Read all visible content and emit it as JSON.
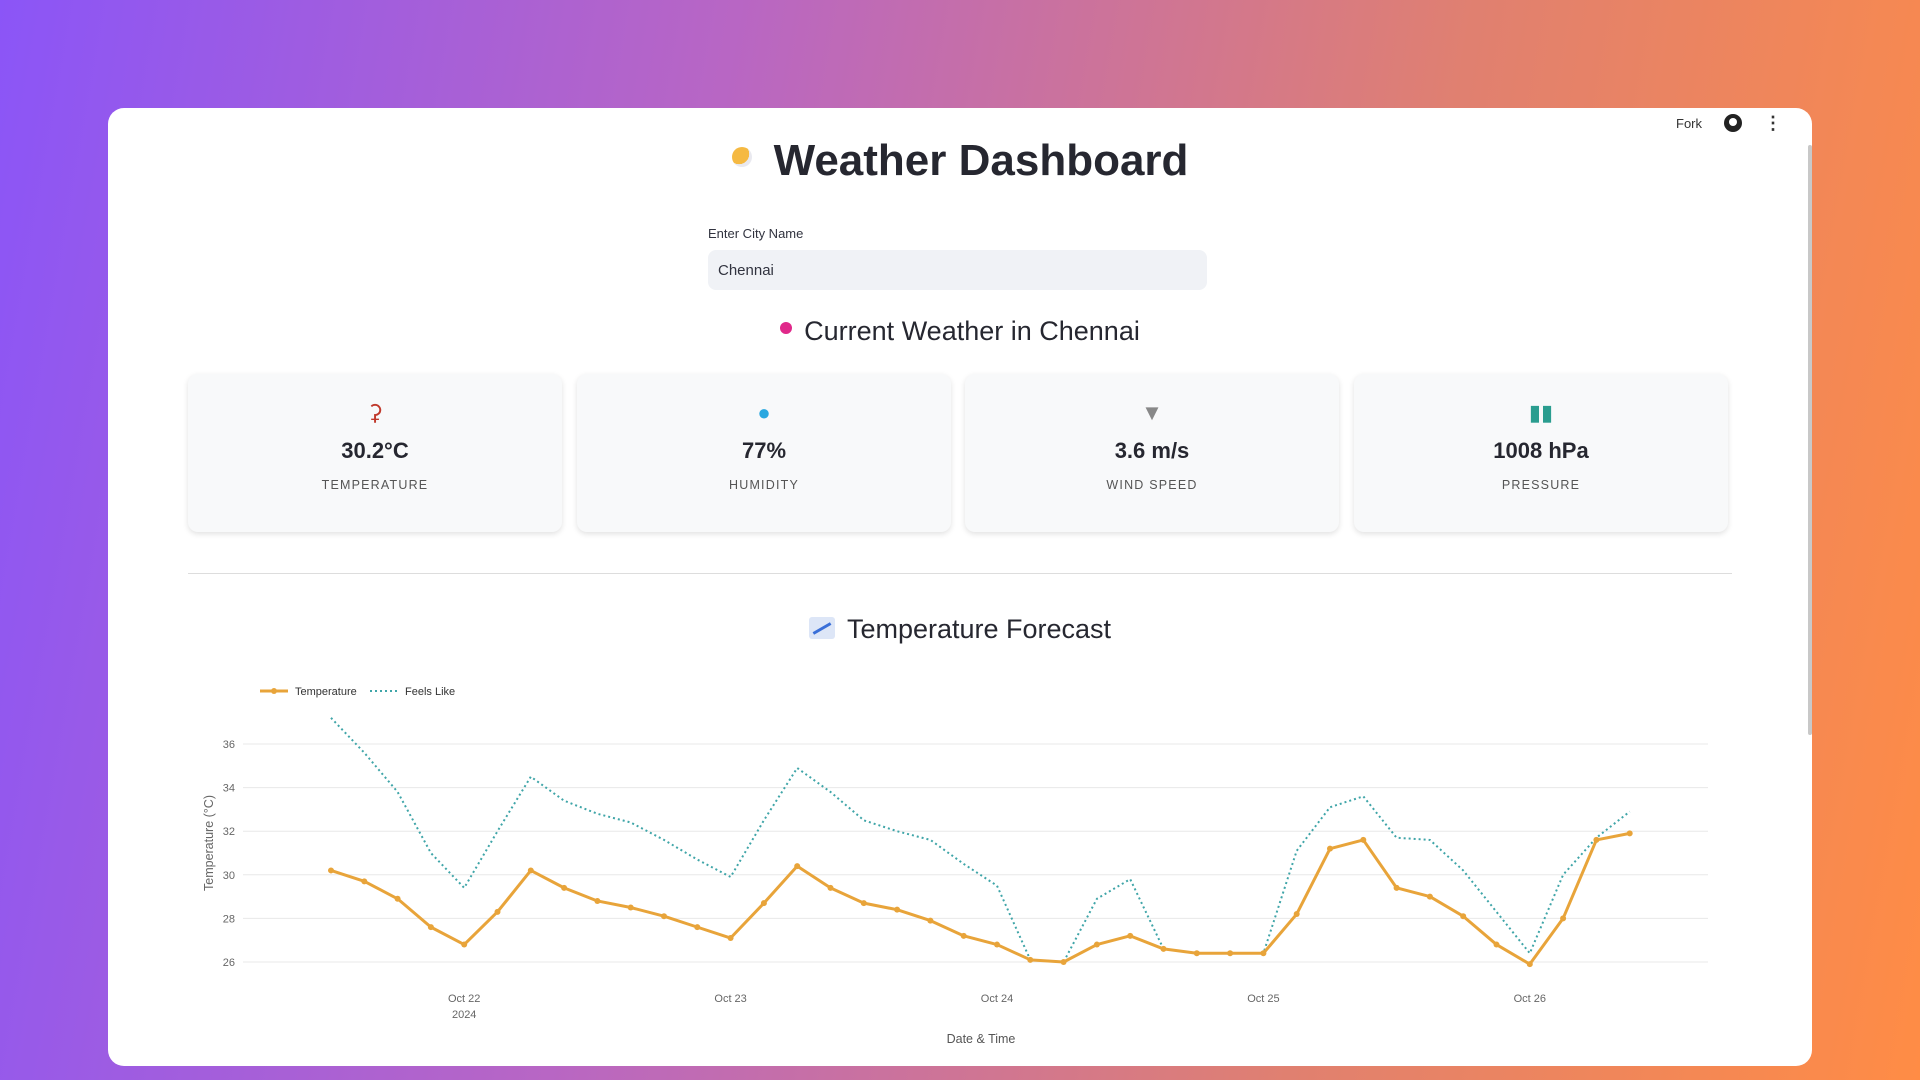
{
  "topbar": {
    "fork": "Fork"
  },
  "title": "Weather Dashboard",
  "city_input": {
    "label": "Enter City Name",
    "value": "Chennai"
  },
  "current_heading": "Current Weather in Chennai",
  "metrics": [
    {
      "icon": "thermometer-icon",
      "value": "30.2°C",
      "label": "TEMPERATURE"
    },
    {
      "icon": "droplet-icon",
      "value": "77%",
      "label": "HUMIDITY"
    },
    {
      "icon": "tornado-icon",
      "value": "3.6 m/s",
      "label": "WIND SPEED"
    },
    {
      "icon": "bar-chart-icon",
      "value": "1008 hPa",
      "label": "PRESSURE"
    }
  ],
  "forecast_heading": "Temperature Forecast",
  "chart_data": {
    "type": "line",
    "xlabel": "Date & Time",
    "ylabel": "Temperature (°C)",
    "x_start": "2024-10-21 12:00",
    "x_step_hours": 3,
    "x_ticks": [
      {
        "index": 4,
        "label": "Oct 22",
        "sub": "2024"
      },
      {
        "index": 12,
        "label": "Oct 23"
      },
      {
        "index": 20,
        "label": "Oct 24"
      },
      {
        "index": 28,
        "label": "Oct 25"
      },
      {
        "index": 36,
        "label": "Oct 26"
      }
    ],
    "y_ticks": [
      26,
      28,
      30,
      32,
      34,
      36
    ],
    "ylim": [
      25.2,
      37.5
    ],
    "grid": true,
    "legend": "top-left",
    "series": [
      {
        "name": "Temperature",
        "color": "#e8a43a",
        "style": "solid-markers",
        "values": [
          30.2,
          29.7,
          28.9,
          27.6,
          26.8,
          28.3,
          30.2,
          29.4,
          28.8,
          28.5,
          28.1,
          27.6,
          27.1,
          28.7,
          30.4,
          29.4,
          28.7,
          28.4,
          27.9,
          27.2,
          26.8,
          26.1,
          26.0,
          26.8,
          27.2,
          26.6,
          26.4,
          26.4,
          26.4,
          28.2,
          31.2,
          31.6,
          29.4,
          29.0,
          28.1,
          26.8,
          25.9,
          28.0,
          31.6,
          31.9
        ]
      },
      {
        "name": "Feels Like",
        "color": "#3fa5a8",
        "style": "dotted",
        "values": [
          37.2,
          35.6,
          33.8,
          31.0,
          29.4,
          32.0,
          34.5,
          33.4,
          32.8,
          32.4,
          31.6,
          30.7,
          29.9,
          32.5,
          34.9,
          33.8,
          32.5,
          32.0,
          31.6,
          30.5,
          29.5,
          26.1,
          26.0,
          28.9,
          29.8,
          26.6,
          26.4,
          26.4,
          26.4,
          31.1,
          33.1,
          33.6,
          31.7,
          31.6,
          30.2,
          28.3,
          26.4,
          30.0,
          31.7,
          32.9
        ]
      }
    ]
  }
}
